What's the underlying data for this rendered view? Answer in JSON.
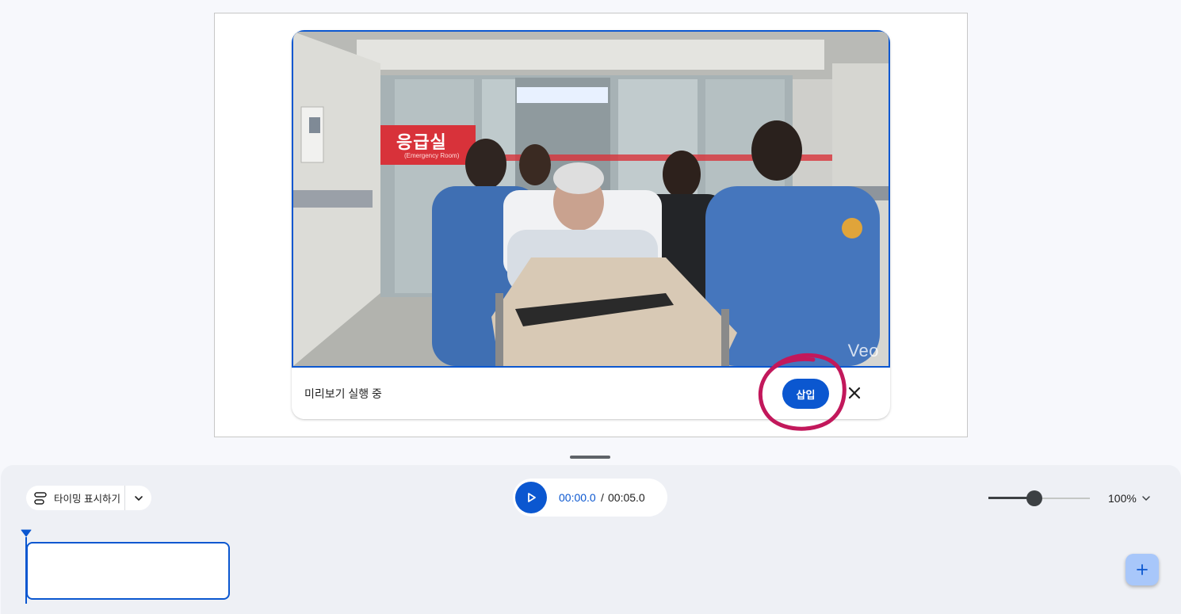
{
  "preview": {
    "status_text": "미리보기 실행 중",
    "insert_label": "삽입",
    "watermark": "Veo",
    "sign_text": "응급실",
    "sign_subtext": "(Emergency Room)",
    "close_icon": "close-icon"
  },
  "timeline": {
    "timing_label": "타이밍 표시하기",
    "timing_icon": "timing-icon",
    "timing_menu_icon": "chevron-down-icon",
    "current_time": "00:00.0",
    "separator": "/",
    "total_time": "00:05.0",
    "play_icon": "play-icon",
    "zoom_level": 0.45,
    "zoom_label": "100%",
    "zoom_menu_icon": "chevron-down-icon",
    "add_icon": "plus-icon"
  },
  "colors": {
    "accent": "#0b57d0",
    "annotation": "#c2185b",
    "add_button": "#a8c7fa",
    "panel": "#eef0f5"
  }
}
